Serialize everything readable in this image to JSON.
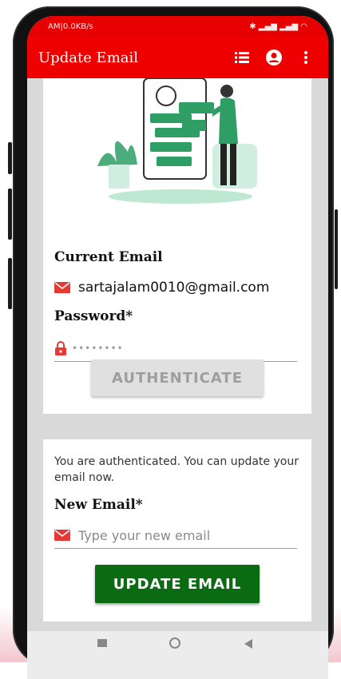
{
  "status_bar": {
    "left": "AM|0.0KB/s",
    "right": ""
  },
  "app_bar": {
    "title": "Update Email",
    "icons": [
      "list-icon",
      "account-icon",
      "more-vert-icon"
    ]
  },
  "auth_card": {
    "current_email_label": "Current Email",
    "current_email": "sartajalam0010@gmail.com",
    "password_label": "Password*",
    "password_value": "••••••••",
    "authenticate_label": "AUTHENTICATE"
  },
  "update_card": {
    "info": "You are authenticated. You can update your email now.",
    "new_email_label": "New Email*",
    "new_email_placeholder": "Type your new email",
    "update_label": "UPDATE EMAIL"
  },
  "colors": {
    "brand_red": "#ee0000",
    "action_green": "#0b6b12",
    "illustration_green": "#2e9e64"
  }
}
